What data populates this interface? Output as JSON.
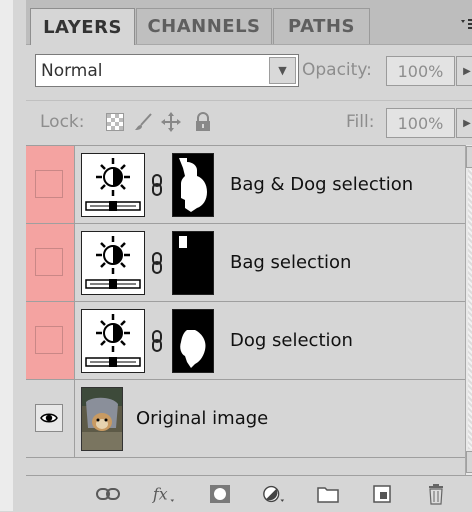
{
  "tabs": [
    {
      "label": "LAYERS",
      "active": true
    },
    {
      "label": "CHANNELS",
      "active": false
    },
    {
      "label": "PATHS",
      "active": false
    }
  ],
  "panel_menu_icon": "panel-menu-icon",
  "blend_mode": "Normal",
  "opacity": {
    "label": "Opacity:",
    "value": "100%"
  },
  "lock": {
    "label": "Lock:",
    "icons": [
      "lock-transparent-icon",
      "lock-paint-icon",
      "lock-position-icon",
      "lock-all-icon"
    ]
  },
  "fill": {
    "label": "Fill:",
    "value": "100%"
  },
  "layers": [
    {
      "name": "Bag & Dog selection",
      "type": "adjustment",
      "mask": "bag-dog"
    },
    {
      "name": "Bag selection",
      "type": "adjustment",
      "mask": "bag"
    },
    {
      "name": "Dog selection",
      "type": "adjustment",
      "mask": "dog"
    },
    {
      "name": "Original image",
      "type": "image",
      "visible": true
    }
  ],
  "bottom_icons": [
    "link-layers-icon",
    "fx-icon",
    "add-mask-icon",
    "adjustment-layer-icon",
    "new-group-icon",
    "new-layer-icon",
    "trash-icon"
  ],
  "colors": {
    "visibility_highlight": "#f4a3a1",
    "panel_bg": "#d6d6d6"
  }
}
